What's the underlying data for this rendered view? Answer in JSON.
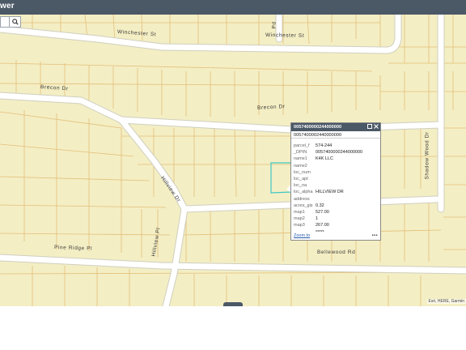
{
  "app": {
    "title": "wer"
  },
  "search": {
    "icon": "search-icon"
  },
  "colors": {
    "header": "#4b5866",
    "map_bg": "#f4eec4",
    "parcel_line": "#e3bf7a",
    "road": "#ffffff",
    "selection": "#3ec8c4"
  },
  "map": {
    "roads": [
      {
        "id": "winchester",
        "label": "Winchester St"
      },
      {
        "id": "winchester-2",
        "label": "Winchester St"
      },
      {
        "id": "brecon",
        "label": "Brecon Dr"
      },
      {
        "id": "brecon-2",
        "label": "Brecon Dr"
      },
      {
        "id": "hillview-dr",
        "label": "Hillview Dr"
      },
      {
        "id": "hillview-pl",
        "label": "Hillview Pl"
      },
      {
        "id": "pine-ridge",
        "label": "Pine Ridge Pl"
      },
      {
        "id": "bellewood",
        "label": "Bellewood Rd"
      },
      {
        "id": "shadow-wood",
        "label": "Shadow Wood Dr"
      },
      {
        "id": "top-road",
        "label": "Pd"
      }
    ]
  },
  "popup": {
    "title": "0057400000244000000",
    "subtitle": "0057400002440000000",
    "fields": [
      {
        "key": "parcel_f",
        "value": "574-244"
      },
      {
        "key": "_DPIN",
        "value": "0057400000244000000"
      },
      {
        "key": "name1",
        "value": "K4K LLC"
      },
      {
        "key": "name2",
        "value": ""
      },
      {
        "key": "loc_num",
        "value": ""
      },
      {
        "key": "loc_apt",
        "value": ""
      },
      {
        "key": "loc_na",
        "value": ""
      },
      {
        "key": "loc_alpha",
        "value": "HILLVIEW DR"
      },
      {
        "key": "address",
        "value": ""
      },
      {
        "key": "acres_gis",
        "value": "0.32"
      },
      {
        "key": "map1",
        "value": "527.00"
      },
      {
        "key": "map2",
        "value": "1"
      },
      {
        "key": "map3",
        "value": "267.00"
      },
      {
        "key": "",
        "value": "*****"
      }
    ],
    "zoom_label": "Zoom to",
    "more_label": "•••",
    "maximize_icon": "maximize-icon",
    "close_icon": "close-icon"
  },
  "attribution": "Esri, HERE, Garmin"
}
